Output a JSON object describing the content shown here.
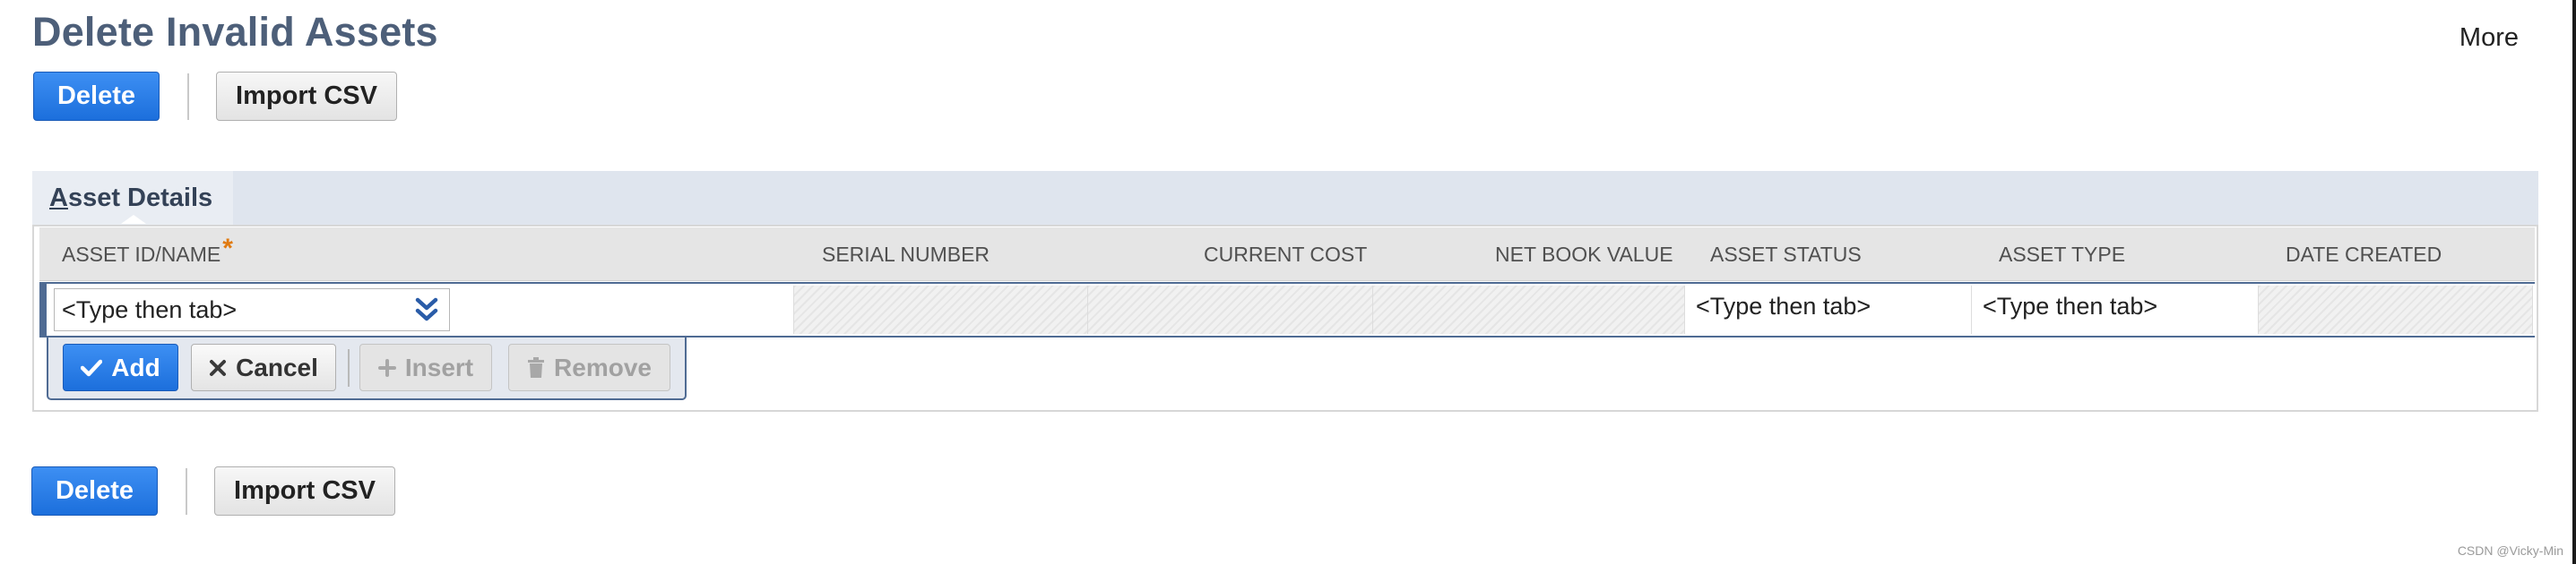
{
  "page": {
    "title": "Delete Invalid Assets",
    "more_label": "More"
  },
  "toolbar_top": {
    "delete_label": "Delete",
    "import_label": "Import CSV"
  },
  "toolbar_bottom": {
    "delete_label": "Delete",
    "import_label": "Import CSV"
  },
  "subtab": {
    "accesskey": "A",
    "label_rest": "sset Details"
  },
  "grid": {
    "columns": [
      {
        "label": "ASSET ID/NAME",
        "required": true,
        "required_mark": "*"
      },
      {
        "label": "SERIAL NUMBER"
      },
      {
        "label": "CURRENT COST"
      },
      {
        "label": "NET BOOK VALUE"
      },
      {
        "label": "ASSET STATUS"
      },
      {
        "label": "ASSET TYPE"
      },
      {
        "label": "DATE CREATED"
      }
    ],
    "edit_row": {
      "asset_id_value": "<Type then tab>",
      "asset_status_value": "<Type then tab>",
      "asset_type_value": "<Type then tab>"
    },
    "actions": {
      "add_label": "Add",
      "cancel_label": "Cancel",
      "insert_label": "Insert",
      "remove_label": "Remove"
    }
  },
  "watermark": "CSDN @Vicky-Min",
  "icons": {
    "dropdown": "double-chevron-down-icon",
    "add": "checkmark-icon",
    "cancel": "x-icon",
    "insert": "plus-icon",
    "remove": "trash-icon"
  },
  "colors": {
    "primary": "#1c6fdc",
    "title": "#4d5f79",
    "accent_border": "#4f6b93",
    "required": "#e07a10"
  }
}
